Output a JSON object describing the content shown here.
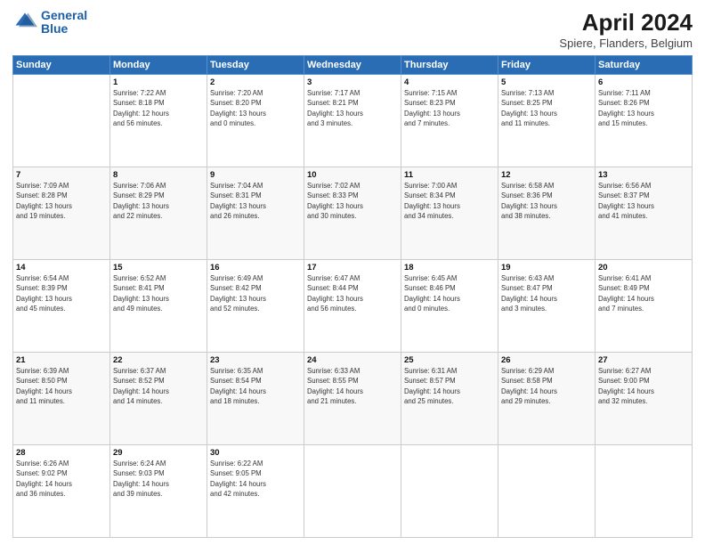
{
  "logo": {
    "line1": "General",
    "line2": "Blue"
  },
  "title": "April 2024",
  "subtitle": "Spiere, Flanders, Belgium",
  "headers": [
    "Sunday",
    "Monday",
    "Tuesday",
    "Wednesday",
    "Thursday",
    "Friday",
    "Saturday"
  ],
  "weeks": [
    [
      {
        "day": "",
        "info": ""
      },
      {
        "day": "1",
        "info": "Sunrise: 7:22 AM\nSunset: 8:18 PM\nDaylight: 12 hours\nand 56 minutes."
      },
      {
        "day": "2",
        "info": "Sunrise: 7:20 AM\nSunset: 8:20 PM\nDaylight: 13 hours\nand 0 minutes."
      },
      {
        "day": "3",
        "info": "Sunrise: 7:17 AM\nSunset: 8:21 PM\nDaylight: 13 hours\nand 3 minutes."
      },
      {
        "day": "4",
        "info": "Sunrise: 7:15 AM\nSunset: 8:23 PM\nDaylight: 13 hours\nand 7 minutes."
      },
      {
        "day": "5",
        "info": "Sunrise: 7:13 AM\nSunset: 8:25 PM\nDaylight: 13 hours\nand 11 minutes."
      },
      {
        "day": "6",
        "info": "Sunrise: 7:11 AM\nSunset: 8:26 PM\nDaylight: 13 hours\nand 15 minutes."
      }
    ],
    [
      {
        "day": "7",
        "info": "Sunrise: 7:09 AM\nSunset: 8:28 PM\nDaylight: 13 hours\nand 19 minutes."
      },
      {
        "day": "8",
        "info": "Sunrise: 7:06 AM\nSunset: 8:29 PM\nDaylight: 13 hours\nand 22 minutes."
      },
      {
        "day": "9",
        "info": "Sunrise: 7:04 AM\nSunset: 8:31 PM\nDaylight: 13 hours\nand 26 minutes."
      },
      {
        "day": "10",
        "info": "Sunrise: 7:02 AM\nSunset: 8:33 PM\nDaylight: 13 hours\nand 30 minutes."
      },
      {
        "day": "11",
        "info": "Sunrise: 7:00 AM\nSunset: 8:34 PM\nDaylight: 13 hours\nand 34 minutes."
      },
      {
        "day": "12",
        "info": "Sunrise: 6:58 AM\nSunset: 8:36 PM\nDaylight: 13 hours\nand 38 minutes."
      },
      {
        "day": "13",
        "info": "Sunrise: 6:56 AM\nSunset: 8:37 PM\nDaylight: 13 hours\nand 41 minutes."
      }
    ],
    [
      {
        "day": "14",
        "info": "Sunrise: 6:54 AM\nSunset: 8:39 PM\nDaylight: 13 hours\nand 45 minutes."
      },
      {
        "day": "15",
        "info": "Sunrise: 6:52 AM\nSunset: 8:41 PM\nDaylight: 13 hours\nand 49 minutes."
      },
      {
        "day": "16",
        "info": "Sunrise: 6:49 AM\nSunset: 8:42 PM\nDaylight: 13 hours\nand 52 minutes."
      },
      {
        "day": "17",
        "info": "Sunrise: 6:47 AM\nSunset: 8:44 PM\nDaylight: 13 hours\nand 56 minutes."
      },
      {
        "day": "18",
        "info": "Sunrise: 6:45 AM\nSunset: 8:46 PM\nDaylight: 14 hours\nand 0 minutes."
      },
      {
        "day": "19",
        "info": "Sunrise: 6:43 AM\nSunset: 8:47 PM\nDaylight: 14 hours\nand 3 minutes."
      },
      {
        "day": "20",
        "info": "Sunrise: 6:41 AM\nSunset: 8:49 PM\nDaylight: 14 hours\nand 7 minutes."
      }
    ],
    [
      {
        "day": "21",
        "info": "Sunrise: 6:39 AM\nSunset: 8:50 PM\nDaylight: 14 hours\nand 11 minutes."
      },
      {
        "day": "22",
        "info": "Sunrise: 6:37 AM\nSunset: 8:52 PM\nDaylight: 14 hours\nand 14 minutes."
      },
      {
        "day": "23",
        "info": "Sunrise: 6:35 AM\nSunset: 8:54 PM\nDaylight: 14 hours\nand 18 minutes."
      },
      {
        "day": "24",
        "info": "Sunrise: 6:33 AM\nSunset: 8:55 PM\nDaylight: 14 hours\nand 21 minutes."
      },
      {
        "day": "25",
        "info": "Sunrise: 6:31 AM\nSunset: 8:57 PM\nDaylight: 14 hours\nand 25 minutes."
      },
      {
        "day": "26",
        "info": "Sunrise: 6:29 AM\nSunset: 8:58 PM\nDaylight: 14 hours\nand 29 minutes."
      },
      {
        "day": "27",
        "info": "Sunrise: 6:27 AM\nSunset: 9:00 PM\nDaylight: 14 hours\nand 32 minutes."
      }
    ],
    [
      {
        "day": "28",
        "info": "Sunrise: 6:26 AM\nSunset: 9:02 PM\nDaylight: 14 hours\nand 36 minutes."
      },
      {
        "day": "29",
        "info": "Sunrise: 6:24 AM\nSunset: 9:03 PM\nDaylight: 14 hours\nand 39 minutes."
      },
      {
        "day": "30",
        "info": "Sunrise: 6:22 AM\nSunset: 9:05 PM\nDaylight: 14 hours\nand 42 minutes."
      },
      {
        "day": "",
        "info": ""
      },
      {
        "day": "",
        "info": ""
      },
      {
        "day": "",
        "info": ""
      },
      {
        "day": "",
        "info": ""
      }
    ]
  ]
}
